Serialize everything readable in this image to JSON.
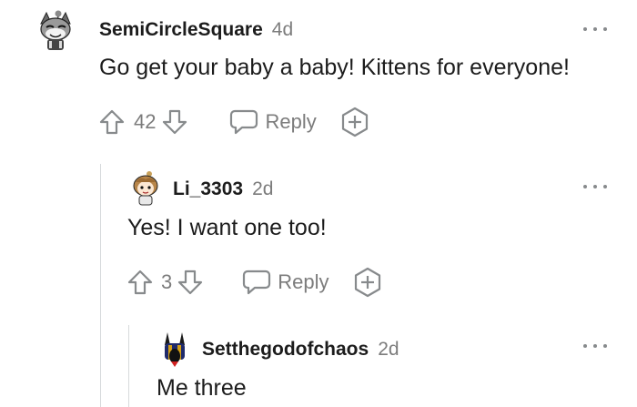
{
  "comments": [
    {
      "username": "SemiCircleSquare",
      "age": "4d",
      "body": "Go get your baby a baby! Kittens for everyone!",
      "votes": "42",
      "reply_label": "Reply",
      "avatar_icon": "cat-avatar-icon"
    },
    {
      "username": "Li_3303",
      "age": "2d",
      "body": "Yes! I want one too!",
      "votes": "3",
      "reply_label": "Reply",
      "avatar_icon": "girl-avatar-icon"
    },
    {
      "username": "Setthegodofchaos",
      "age": "2d",
      "body": "Me three",
      "avatar_icon": "jackal-avatar-icon"
    }
  ],
  "colors": {
    "text": "#1c1c1c",
    "muted": "#7c7c7c",
    "icon": "#878a8c",
    "thread_line": "#d7dadc"
  }
}
